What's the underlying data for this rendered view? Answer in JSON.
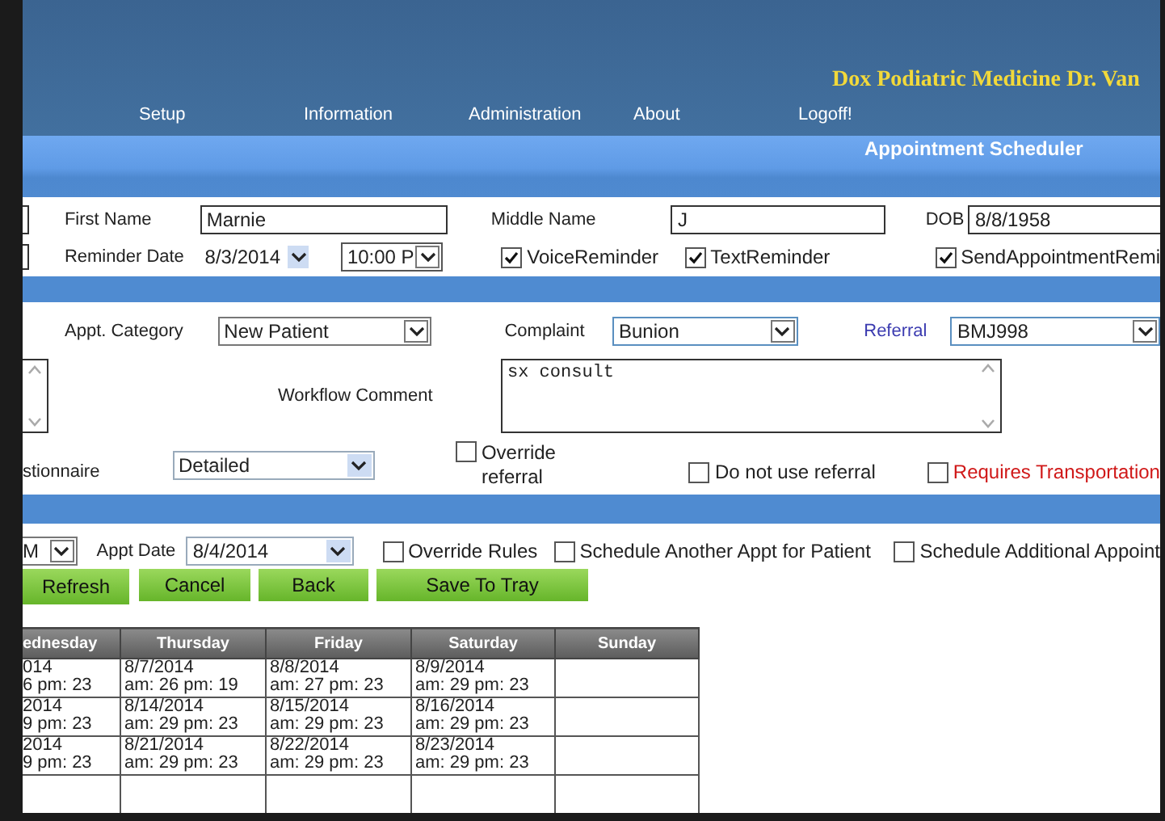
{
  "header": {
    "practice_title": "Dox Podiatric Medicine Dr. Van",
    "menu": [
      {
        "label": "Setup"
      },
      {
        "label": "Information"
      },
      {
        "label": "Administration"
      },
      {
        "label": "About"
      },
      {
        "label": "Logoff!"
      }
    ],
    "page_title": "Appointment Scheduler"
  },
  "patient": {
    "first_name": {
      "label": "First Name",
      "value": "Marnie"
    },
    "middle_name": {
      "label": "Middle Name",
      "value": "J"
    },
    "dob": {
      "label": "DOB",
      "value": "8/8/1958"
    },
    "reminder": {
      "label": "Reminder Date",
      "date": "8/3/2014",
      "time": "10:00 P"
    },
    "reminder_options": [
      {
        "label": "VoiceReminder",
        "checked": true
      },
      {
        "label": "TextReminder",
        "checked": true
      },
      {
        "label": "SendAppointmentRemi",
        "checked": true
      }
    ]
  },
  "appointment": {
    "category": {
      "label": "Appt. Category",
      "value": "New Patient"
    },
    "complaint": {
      "label": "Complaint",
      "value": "Bunion"
    },
    "referral": {
      "label": "Referral",
      "value": "BMJ998"
    },
    "workflow_comment": {
      "label": "Workflow Comment",
      "value": "sx consult"
    },
    "questionnaire": {
      "label": "stionnaire",
      "value": "Detailed"
    },
    "options": [
      {
        "label": "Override referral",
        "checked": false,
        "kind": "plain"
      },
      {
        "label": "Do not use referral",
        "checked": false,
        "kind": "plain"
      },
      {
        "label": "Requires Transportation",
        "checked": false,
        "kind": "warning"
      }
    ]
  },
  "scheduling": {
    "period": "M",
    "appt_date": {
      "label": "Appt Date",
      "value": "8/4/2014"
    },
    "options": [
      {
        "label": "Override Rules",
        "checked": false
      },
      {
        "label": "Schedule Another Appt for Patient",
        "checked": false
      },
      {
        "label": "Schedule Additional Appoint",
        "checked": false
      }
    ],
    "buttons": [
      {
        "label": "Refresh"
      },
      {
        "label": "Cancel"
      },
      {
        "label": "Back"
      },
      {
        "label": "Save To Tray"
      }
    ]
  },
  "calendar": {
    "columns": [
      "ednesday",
      "Thursday",
      "Friday",
      "Saturday",
      "Sunday"
    ],
    "rows": [
      [
        {
          "date": "014",
          "slots": "6 pm: 23"
        },
        {
          "date": "8/7/2014",
          "slots": "am: 26 pm: 19"
        },
        {
          "date": "8/8/2014",
          "slots": "am: 27 pm: 23"
        },
        {
          "date": "8/9/2014",
          "slots": "am: 29 pm: 23"
        }
      ],
      [
        {
          "date": "2014",
          "slots": "9 pm: 23"
        },
        {
          "date": "8/14/2014",
          "slots": "am: 29 pm: 23"
        },
        {
          "date": "8/15/2014",
          "slots": "am: 29 pm: 23"
        },
        {
          "date": "8/16/2014",
          "slots": "am: 29 pm: 23"
        }
      ],
      [
        {
          "date": "2014",
          "slots": "9 pm: 23"
        },
        {
          "date": "8/21/2014",
          "slots": "am: 29 pm: 23"
        },
        {
          "date": "8/22/2014",
          "slots": "am: 29 pm: 23"
        },
        {
          "date": "8/23/2014",
          "slots": "am: 29 pm: 23"
        }
      ]
    ]
  }
}
